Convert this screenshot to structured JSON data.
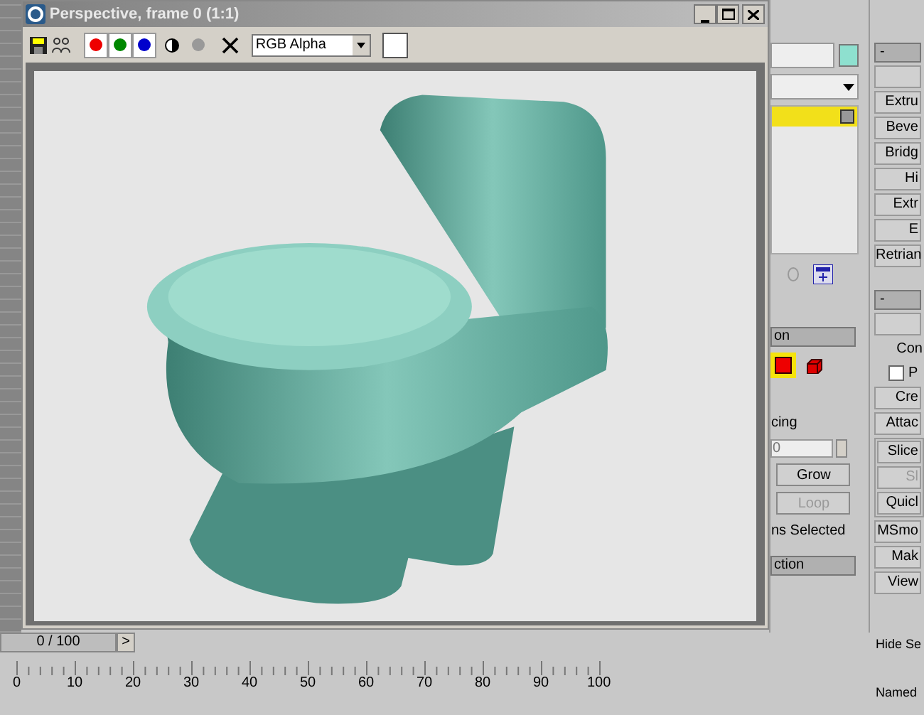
{
  "render_window": {
    "title": "Perspective, frame 0 (1:1)",
    "channels": [
      {
        "kind": "red",
        "on": true
      },
      {
        "kind": "green",
        "on": true
      },
      {
        "kind": "blue",
        "on": true
      }
    ],
    "channel_dropdown": "RGB Alpha"
  },
  "modifier_panel": {
    "stack_items": [
      {
        "selected": true
      }
    ]
  },
  "selection_rollout": {
    "title": "on",
    "levels": [
      {
        "kind": "polygon",
        "selected": true
      },
      {
        "kind": "element",
        "selected": false
      }
    ],
    "spacing_label": "cing",
    "spacing_value": "0",
    "buttons": [
      {
        "label": "Grow",
        "disabled": false
      },
      {
        "label": "Loop",
        "disabled": true
      }
    ],
    "status": "ns Selected"
  },
  "soft_selection_rollout": {
    "title": "ction"
  },
  "edit_rollout": {
    "toggle": "-",
    "buttons": [
      "Extru",
      "Beve",
      "Bridg",
      "Hi",
      "Extr",
      "E",
      "Retrian"
    ]
  },
  "geometry_rollout": {
    "toggle": "-",
    "constraints_label": "Con",
    "preserve": {
      "label": "P",
      "checked": false
    },
    "buttons": [
      {
        "label": "Cre",
        "disabled": false
      },
      {
        "label": "Attac",
        "disabled": false
      }
    ],
    "group_buttons": [
      {
        "label": "Slice",
        "disabled": false
      },
      {
        "label": "Sl",
        "disabled": true
      },
      {
        "label": "Quicl",
        "disabled": false
      }
    ],
    "more_buttons": [
      {
        "label": "MSmo",
        "disabled": false
      },
      {
        "label": "Mak",
        "disabled": false
      },
      {
        "label": "View",
        "disabled": false
      }
    ]
  },
  "selection_panel": {
    "labels": [
      "Hide Se",
      "Named"
    ]
  },
  "timeline": {
    "frame_label": "0 / 100",
    "next": ">",
    "ruler_labels": [
      "0",
      "10",
      "20",
      "30",
      "40",
      "50",
      "60",
      "70",
      "80",
      "90",
      "100"
    ]
  }
}
